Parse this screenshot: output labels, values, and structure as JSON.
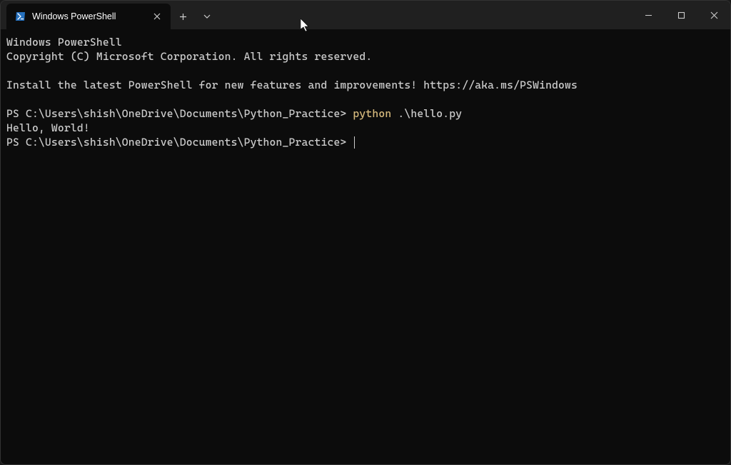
{
  "tab": {
    "title": "Windows PowerShell"
  },
  "terminal": {
    "line1": "Windows PowerShell",
    "line2": "Copyright (C) Microsoft Corporation. All rights reserved.",
    "line3": "Install the latest PowerShell for new features and improvements! https://aka.ms/PSWindows",
    "prompt1": "PS C:\\Users\\shish\\OneDrive\\Documents\\Python_Practice> ",
    "cmd1_program": "python",
    "cmd1_args": " .\\hello.py",
    "output1": "Hello, World!",
    "prompt2": "PS C:\\Users\\shish\\OneDrive\\Documents\\Python_Practice> "
  }
}
